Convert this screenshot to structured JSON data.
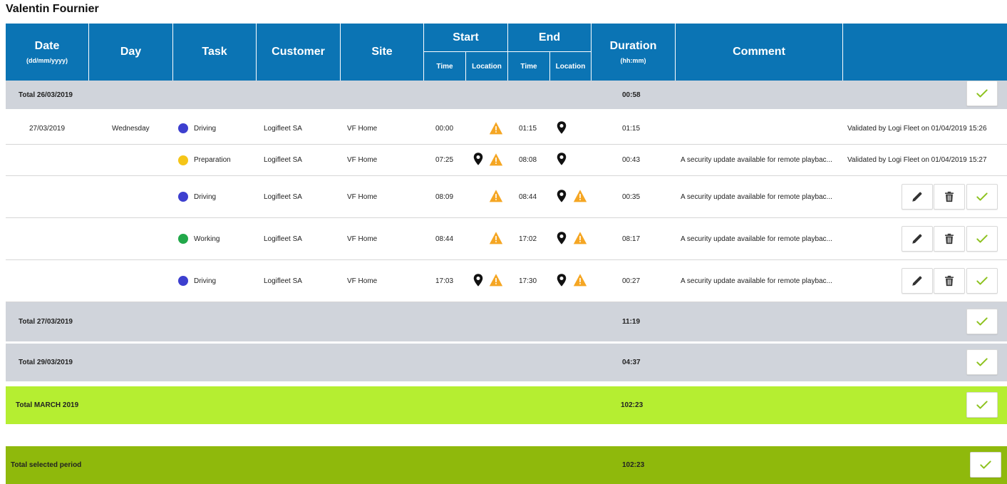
{
  "user_name": "Valentin Fournier",
  "headers": {
    "date": "Date",
    "date_sub": "(dd/mm/yyyy)",
    "day": "Day",
    "task": "Task",
    "customer": "Customer",
    "site": "Site",
    "start": "Start",
    "end": "End",
    "time": "Time",
    "location": "Location",
    "duration": "Duration",
    "duration_sub": "(hh:mm)",
    "comment": "Comment"
  },
  "total_0": {
    "label": "Total 26/03/2019",
    "duration": "00:58"
  },
  "rows": [
    {
      "date": "27/03/2019",
      "day": "Wednesday",
      "task": "Driving",
      "customer": "Logifleet SA",
      "site": "VF Home",
      "start_time": "00:00",
      "end_time": "01:15",
      "duration": "01:15",
      "comment": "",
      "status": "Validated by Logi Fleet on 01/04/2019 15:26"
    },
    {
      "date": "",
      "day": "",
      "task": "Preparation",
      "customer": "Logifleet SA",
      "site": "VF Home",
      "start_time": "07:25",
      "end_time": "08:08",
      "duration": "00:43",
      "comment": "A security update available for remote playbac...",
      "status": "Validated by Logi Fleet on 01/04/2019 15:27"
    },
    {
      "date": "",
      "day": "",
      "task": "Driving",
      "customer": "Logifleet SA",
      "site": "VF Home",
      "start_time": "08:09",
      "end_time": "08:44",
      "duration": "00:35",
      "comment": "A security update available for remote playbac...",
      "status": ""
    },
    {
      "date": "",
      "day": "",
      "task": "Working",
      "customer": "Logifleet SA",
      "site": "VF Home",
      "start_time": "08:44",
      "end_time": "17:02",
      "duration": "08:17",
      "comment": "A security update available for remote playbac...",
      "status": ""
    },
    {
      "date": "",
      "day": "",
      "task": "Driving",
      "customer": "Logifleet SA",
      "site": "VF Home",
      "start_time": "17:03",
      "end_time": "17:30",
      "duration": "00:27",
      "comment": "A security update available for remote playbac...",
      "status": ""
    }
  ],
  "total_1": {
    "label": "Total 27/03/2019",
    "duration": "11:19"
  },
  "total_2": {
    "label": "Total 29/03/2019",
    "duration": "04:37"
  },
  "month_total": {
    "label": "Total MARCH 2019",
    "duration": "102:23"
  },
  "period_total": {
    "label": "Total selected period",
    "duration": "102:23"
  },
  "colors": {
    "header_bg": "#0b74b4",
    "driving": "#3d3fcf",
    "preparation": "#f5c518",
    "working": "#22a84a",
    "warning": "#f5a623",
    "check": "#8dc21f",
    "month_bg": "#b5ee31",
    "period_bg": "#8fb90c",
    "total_bg": "#d0d4db"
  }
}
